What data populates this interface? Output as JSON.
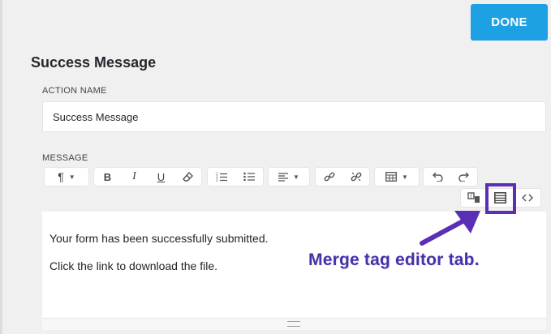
{
  "header": {
    "done_label": "DONE"
  },
  "section": {
    "title": "Success Message"
  },
  "action_name": {
    "label": "ACTION NAME",
    "value": "Success Message"
  },
  "message": {
    "label": "MESSAGE",
    "content": [
      "Your form has been successfully submitted.",
      "Click the link to download the file."
    ]
  },
  "toolbar": {
    "paragraph_glyph": "¶",
    "bold": "B",
    "italic": "I",
    "underline": "U"
  },
  "annotation": {
    "text": "Merge tag editor tab."
  },
  "colors": {
    "accent": "#1ea1e3",
    "annotation": "#5b2fb4"
  }
}
